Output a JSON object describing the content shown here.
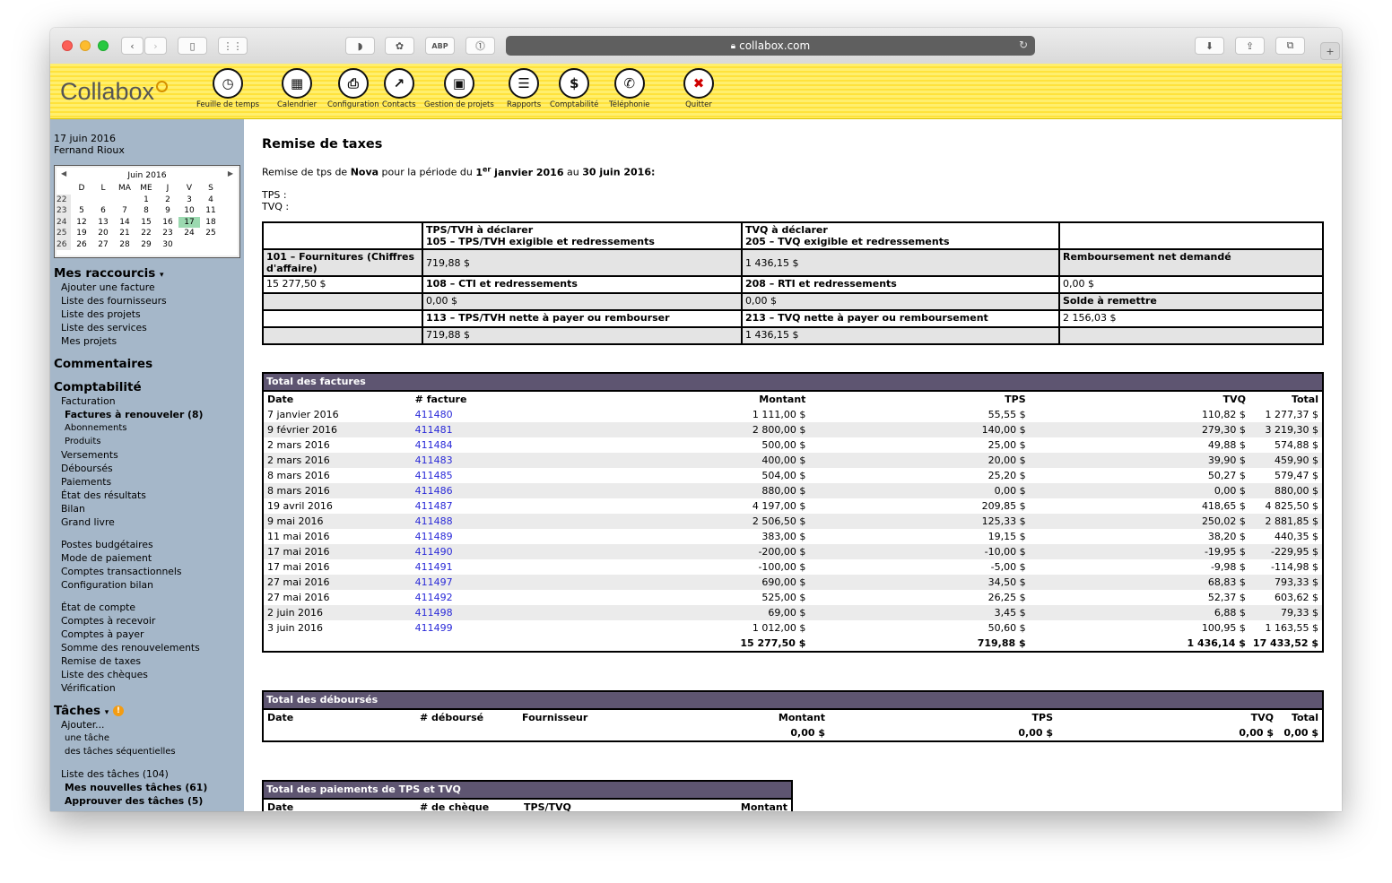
{
  "browser": {
    "url": "collabox.com"
  },
  "header": {
    "logo": "Collabox",
    "nav": [
      {
        "label": "Feuille de temps",
        "icon": "clock-icon",
        "glyph": "◷"
      },
      {
        "label": "Calendrier",
        "icon": "calendar-icon",
        "glyph": "▦"
      },
      {
        "label": "Configuration",
        "icon": "configuration-icon",
        "glyph": "⎙"
      },
      {
        "label": "Contacts",
        "icon": "contacts-icon",
        "glyph": "↗"
      },
      {
        "label": "Gestion de projets",
        "icon": "projects-icon",
        "glyph": "▣"
      },
      {
        "label": "Rapports",
        "icon": "reports-icon",
        "glyph": "☰"
      },
      {
        "label": "Comptabilité",
        "icon": "accounting-icon",
        "glyph": "$"
      },
      {
        "label": "Téléphonie",
        "icon": "phone-icon",
        "glyph": "✆"
      },
      {
        "label": "Quitter",
        "icon": "quit-icon",
        "glyph": "✖"
      }
    ]
  },
  "sidebar": {
    "date": "17 juin 2016",
    "user": "Fernand Rioux",
    "calendar": {
      "month": "Juin 2016",
      "days": [
        "D",
        "L",
        "MA",
        "ME",
        "J",
        "V",
        "S"
      ],
      "weeks": [
        [
          "22",
          "",
          "",
          "",
          "1",
          "2",
          "3",
          "4"
        ],
        [
          "23",
          "5",
          "6",
          "7",
          "8",
          "9",
          "10",
          "11"
        ],
        [
          "24",
          "12",
          "13",
          "14",
          "15",
          "16",
          "17",
          "18"
        ],
        [
          "25",
          "19",
          "20",
          "21",
          "22",
          "23",
          "24",
          "25"
        ],
        [
          "26",
          "26",
          "27",
          "28",
          "29",
          "30",
          "",
          ""
        ]
      ]
    },
    "shortcuts_title": "Mes raccourcis",
    "shortcuts": [
      "Ajouter une facture",
      "Liste des fournisseurs",
      "Liste des projets",
      "Liste des services",
      "Mes projets"
    ],
    "comments_title": "Commentaires",
    "accounting_title": "Comptabilité",
    "facturation": "Facturation",
    "factures_renouveler": "Factures à renouveler (8)",
    "abonnements": "Abonnements",
    "produits": "Produits",
    "accounting_links1": [
      "Versements",
      "Déboursés",
      "Paiements",
      "État des résultats",
      "Bilan",
      "Grand livre"
    ],
    "accounting_links2": [
      "Postes budgétaires",
      "Mode de paiement",
      "Comptes transactionnels",
      "Configuration bilan"
    ],
    "accounting_links3": [
      "État de compte",
      "Comptes à recevoir",
      "Comptes à payer",
      "Somme des renouvelements",
      "Remise de taxes",
      "Liste des chèques",
      "Vérification"
    ],
    "tasks_title": "Tâches",
    "tasks_add": "Ajouter...",
    "tasks_one": "une tâche",
    "tasks_seq": "des tâches séquentielles",
    "tasks_list": "Liste des tâches (104)",
    "tasks_new": "Mes nouvelles tâches (61)",
    "tasks_approve": "Approuver des tâches (5)"
  },
  "main": {
    "title": "Remise de taxes",
    "period_a": "Remise de tps de ",
    "period_company": "Nova",
    "period_b": " pour la période du ",
    "period_start_day": "1",
    "period_start_sup": "er",
    "period_start_rest": " janvier 2016",
    "period_c": " au ",
    "period_end": "30 juin 2016:",
    "tps_label": "TPS :",
    "tvq_label": "TVQ :",
    "tax_table": {
      "h1_a": "TPS/TVH à déclarer",
      "h1_b": "105 – TPS/TVH exigible et redressements",
      "h2_a": "TVQ à déclarer",
      "h2_b": "205 – TVQ exigible et redressements",
      "r101": "101 – Fournitures (Chiffres d'affaire)",
      "v105": "719,88 $",
      "v205": "1 436,15 $",
      "rembourse": "Remboursement net demandé",
      "v101": "15 277,50 $",
      "l108": "108 – CTI et redressements",
      "l208": "208 – RTI et redressements",
      "vremb": "0,00 $",
      "v108": "0,00 $",
      "v208": "0,00 $",
      "solde": "Solde à remettre",
      "l113": "113 – TPS/TVH nette à payer ou rembourser",
      "l213": "213 – TVQ nette à payer ou remboursement",
      "vsolde": "2 156,03 $",
      "v113": "719,88 $",
      "v213": "1 436,15 $"
    },
    "invoices": {
      "title": "Total des factures",
      "columns": [
        "Date",
        "# facture",
        "Montant",
        "TPS",
        "TVQ",
        "Total"
      ],
      "rows": [
        [
          "7 janvier 2016",
          "411480",
          "1 111,00 $",
          "55,55 $",
          "110,82 $",
          "1 277,37 $"
        ],
        [
          "9 février 2016",
          "411481",
          "2 800,00 $",
          "140,00 $",
          "279,30 $",
          "3 219,30 $"
        ],
        [
          "2 mars 2016",
          "411484",
          "500,00 $",
          "25,00 $",
          "49,88 $",
          "574,88 $"
        ],
        [
          "2 mars 2016",
          "411483",
          "400,00 $",
          "20,00 $",
          "39,90 $",
          "459,90 $"
        ],
        [
          "8 mars 2016",
          "411485",
          "504,00 $",
          "25,20 $",
          "50,27 $",
          "579,47 $"
        ],
        [
          "8 mars 2016",
          "411486",
          "880,00 $",
          "0,00 $",
          "0,00 $",
          "880,00 $"
        ],
        [
          "19 avril 2016",
          "411487",
          "4 197,00 $",
          "209,85 $",
          "418,65 $",
          "4 825,50 $"
        ],
        [
          "9 mai 2016",
          "411488",
          "2 506,50 $",
          "125,33 $",
          "250,02 $",
          "2 881,85 $"
        ],
        [
          "11 mai 2016",
          "411489",
          "383,00 $",
          "19,15 $",
          "38,20 $",
          "440,35 $"
        ],
        [
          "17 mai 2016",
          "411490",
          "-200,00 $",
          "-10,00 $",
          "-19,95 $",
          "-229,95 $"
        ],
        [
          "17 mai 2016",
          "411491",
          "-100,00 $",
          "-5,00 $",
          "-9,98 $",
          "-114,98 $"
        ],
        [
          "27 mai 2016",
          "411497",
          "690,00 $",
          "34,50 $",
          "68,83 $",
          "793,33 $"
        ],
        [
          "27 mai 2016",
          "411492",
          "525,00 $",
          "26,25 $",
          "52,37 $",
          "603,62 $"
        ],
        [
          "2 juin 2016",
          "411498",
          "69,00 $",
          "3,45 $",
          "6,88 $",
          "79,33 $"
        ],
        [
          "3 juin 2016",
          "411499",
          "1 012,00 $",
          "50,60 $",
          "100,95 $",
          "1 163,55 $"
        ]
      ],
      "totals": [
        "15 277,50 $",
        "719,88 $",
        "1 436,14 $",
        "17 433,52 $"
      ]
    },
    "disbursements": {
      "title": "Total des déboursés",
      "columns": [
        "Date",
        "# déboursé",
        "Fournisseur",
        "Montant",
        "TPS",
        "TVQ",
        "Total"
      ],
      "totals": [
        "0,00 $",
        "0,00 $",
        "0,00 $",
        "0,00 $"
      ]
    },
    "payments": {
      "title": "Total des paiements de TPS et TVQ",
      "columns": [
        "Date",
        "# de chèque",
        "TPS/TVQ",
        "Montant"
      ]
    }
  }
}
